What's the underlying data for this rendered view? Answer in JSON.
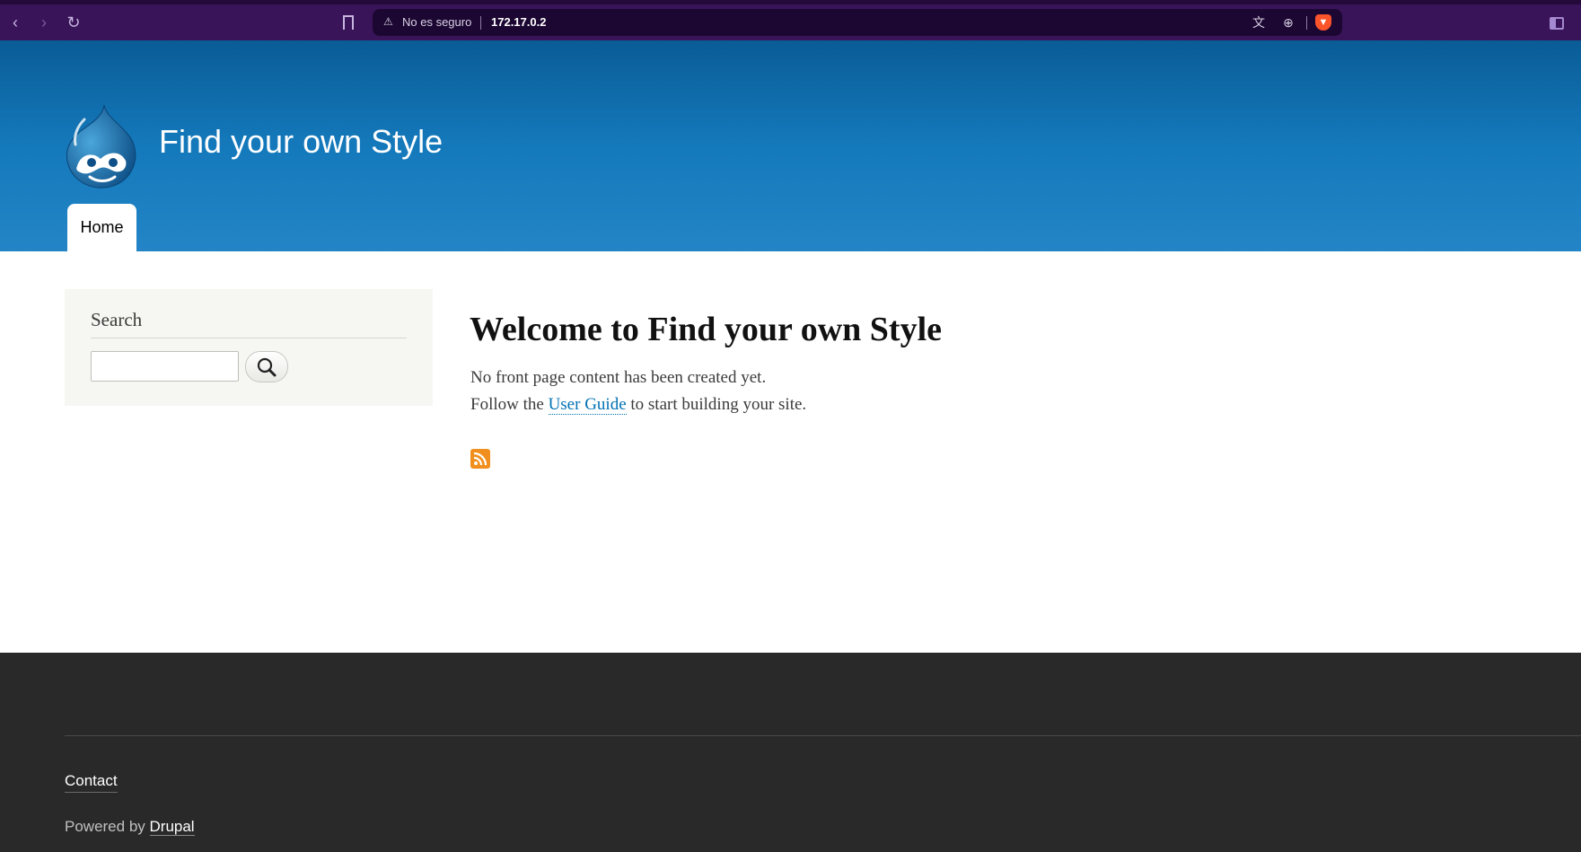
{
  "browser": {
    "security_text": "No es seguro",
    "url": "172.17.0.2"
  },
  "site": {
    "name": "Find your own Style",
    "nav": [
      {
        "label": "Home"
      }
    ]
  },
  "sidebar": {
    "search_title": "Search",
    "search_value": "",
    "search_button_icon": "search-icon"
  },
  "main": {
    "title": "Welcome to Find your own Style",
    "line1": "No front page content has been created yet.",
    "line2_before": "Follow the ",
    "line2_link": "User Guide",
    "line2_after": " to start building your site.",
    "feed_icon": "rss-icon"
  },
  "footer": {
    "contact": "Contact",
    "powered_prefix": "Powered by ",
    "powered_link": "Drupal"
  },
  "colors": {
    "header_top": "#0a5c96",
    "header_bottom": "#2385c6",
    "link": "#0071b3",
    "footer_bg": "#292929",
    "rss": "#f18f1e",
    "browser_bar": "#3a1459"
  }
}
